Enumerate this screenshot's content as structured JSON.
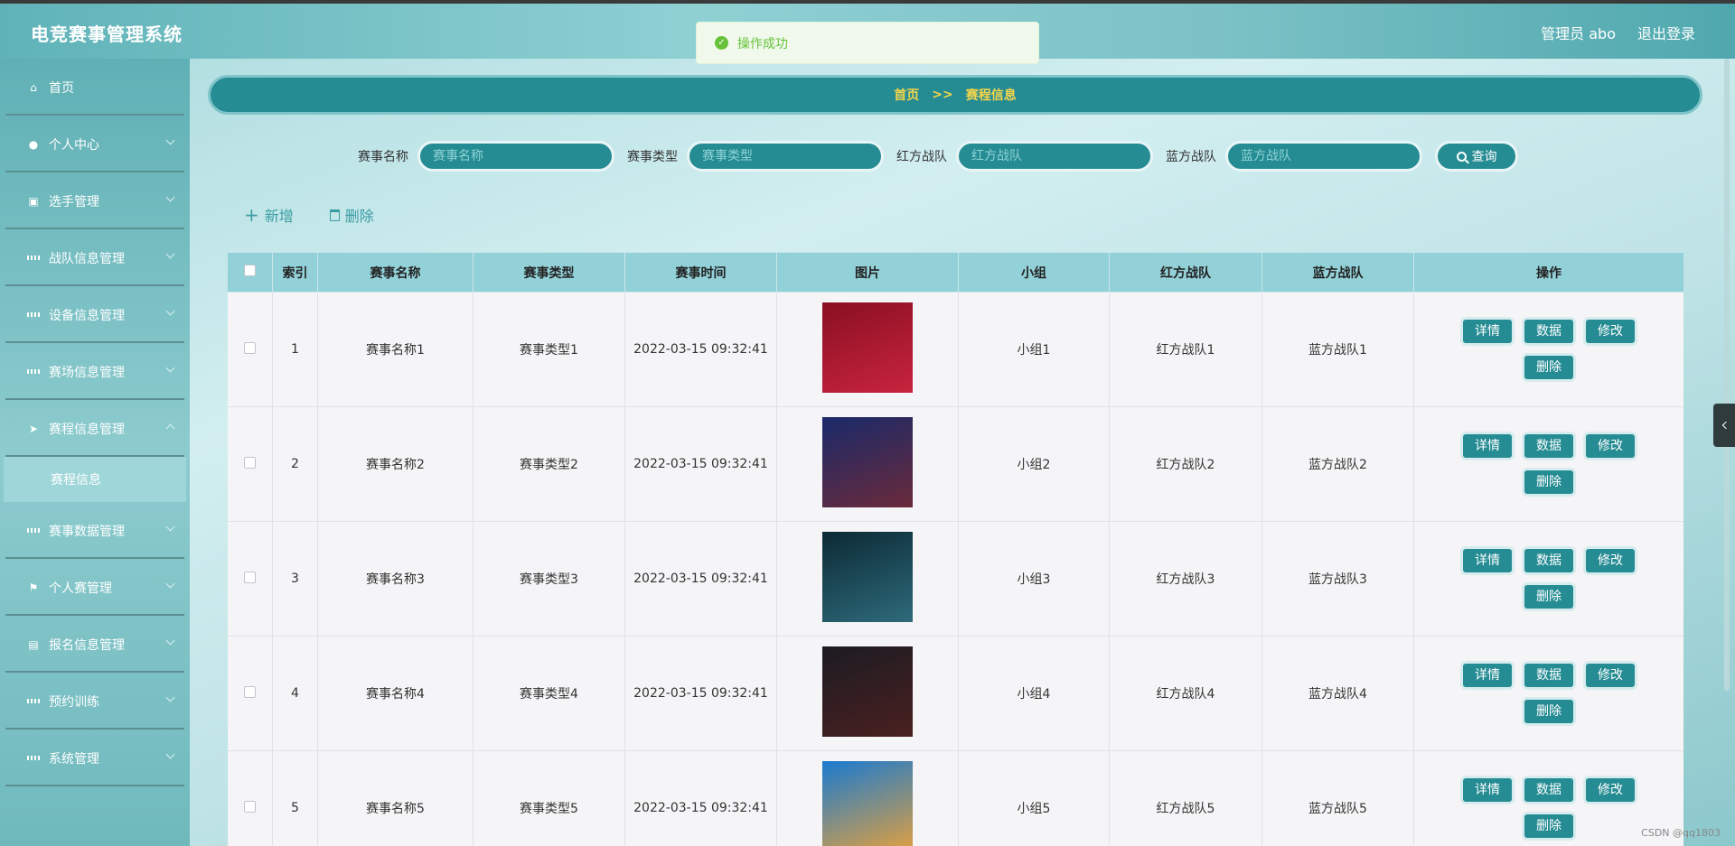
{
  "header": {
    "title": "电竞赛事管理系统",
    "user": "管理员 abo",
    "logout": "退出登录"
  },
  "toast": {
    "message": "操作成功"
  },
  "sidebar": {
    "items": [
      {
        "label": "首页",
        "icon": "home-icon"
      },
      {
        "label": "个人中心",
        "icon": "user-icon"
      },
      {
        "label": "选手管理",
        "icon": "clipboard-icon"
      },
      {
        "label": "战队信息管理",
        "icon": "grid-icon"
      },
      {
        "label": "设备信息管理",
        "icon": "grid-icon"
      },
      {
        "label": "赛场信息管理",
        "icon": "grid-icon"
      },
      {
        "label": "赛程信息管理",
        "icon": "paper-plane-icon"
      },
      {
        "label": "赛事数据管理",
        "icon": "grid-icon"
      },
      {
        "label": "个人赛管理",
        "icon": "flag-icon"
      },
      {
        "label": "报名信息管理",
        "icon": "briefcase-icon"
      },
      {
        "label": "预约训练",
        "icon": "grid-icon"
      },
      {
        "label": "系统管理",
        "icon": "grid-icon"
      }
    ],
    "submenu": {
      "label": "赛程信息"
    }
  },
  "breadcrumb": {
    "home": "首页",
    "sep": ">>",
    "current": "赛程信息"
  },
  "search": {
    "fields": [
      {
        "label": "赛事名称",
        "placeholder": "赛事名称"
      },
      {
        "label": "赛事类型",
        "placeholder": "赛事类型"
      },
      {
        "label": "红方战队",
        "placeholder": "红方战队"
      },
      {
        "label": "蓝方战队",
        "placeholder": "蓝方战队"
      }
    ],
    "button": "查询"
  },
  "actions": {
    "add": "新增",
    "delete": "删除"
  },
  "table": {
    "headers": [
      "索引",
      "赛事名称",
      "赛事类型",
      "赛事时间",
      "图片",
      "小组",
      "红方战队",
      "蓝方战队",
      "操作"
    ],
    "row_buttons": {
      "detail": "详情",
      "data": "数据",
      "edit": "修改",
      "delete": "删除"
    },
    "rows": [
      {
        "index": "1",
        "name": "赛事名称1",
        "type": "赛事类型1",
        "time": "2022-03-15 09:32:41",
        "group": "小组1",
        "red": "红方战队1",
        "blue": "蓝方战队1",
        "img_colors": [
          "#8a0f22",
          "#c8243e"
        ]
      },
      {
        "index": "2",
        "name": "赛事名称2",
        "type": "赛事类型2",
        "time": "2022-03-15 09:32:41",
        "group": "小组2",
        "red": "红方战队2",
        "blue": "蓝方战队2",
        "img_colors": [
          "#1a2a6a",
          "#6a2a3a"
        ]
      },
      {
        "index": "3",
        "name": "赛事名称3",
        "type": "赛事类型3",
        "time": "2022-03-15 09:32:41",
        "group": "小组3",
        "red": "红方战队3",
        "blue": "蓝方战队3",
        "img_colors": [
          "#0c2a35",
          "#2e6a7a"
        ]
      },
      {
        "index": "4",
        "name": "赛事名称4",
        "type": "赛事类型4",
        "time": "2022-03-15 09:32:41",
        "group": "小组4",
        "red": "红方战队4",
        "blue": "蓝方战队4",
        "img_colors": [
          "#1c1c22",
          "#4a2020"
        ]
      },
      {
        "index": "5",
        "name": "赛事名称5",
        "type": "赛事类型5",
        "time": "2022-03-15 09:32:41",
        "group": "小组5",
        "red": "红方战队5",
        "blue": "蓝方战队5",
        "img_colors": [
          "#1a7ad0",
          "#e0a040"
        ]
      }
    ]
  },
  "watermark": "CSDN @qq1803"
}
